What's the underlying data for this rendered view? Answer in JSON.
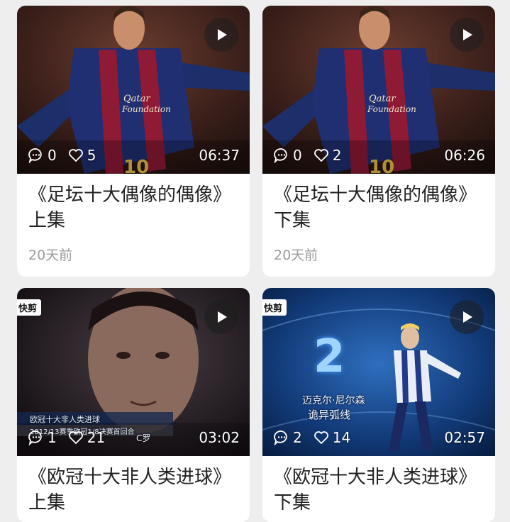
{
  "videos": [
    {
      "title": "《足坛十大偶像的偶像》上集",
      "comments": "0",
      "likes": "5",
      "duration": "06:37",
      "date": "20天前"
    },
    {
      "title": "《足坛十大偶像的偶像》下集",
      "comments": "0",
      "likes": "2",
      "duration": "06:26",
      "date": "20天前"
    },
    {
      "title": "《欧冠十大非人类进球》上集",
      "comments": "1",
      "likes": "21",
      "duration": "03:02",
      "date": "",
      "badge": "快剪",
      "overlay_line1": "欧冠十大非人类进球",
      "overlay_line2": "2012/13赛季欧冠1/8决赛首回合",
      "overlay_tag": "C罗"
    },
    {
      "title": "《欧冠十大非人类进球》下集",
      "comments": "2",
      "likes": "14",
      "duration": "02:57",
      "date": "",
      "badge": "快剪",
      "overlay_rank": "2",
      "overlay_player": "迈克尔·尼尔森",
      "overlay_caption": "诡异弧线"
    }
  ],
  "colors": {
    "background": "#eeeeee",
    "card": "#ffffff",
    "title_text": "#222222",
    "meta_text": "#9a9a9a"
  },
  "icons": [
    "play-icon",
    "comment-icon",
    "heart-icon"
  ]
}
